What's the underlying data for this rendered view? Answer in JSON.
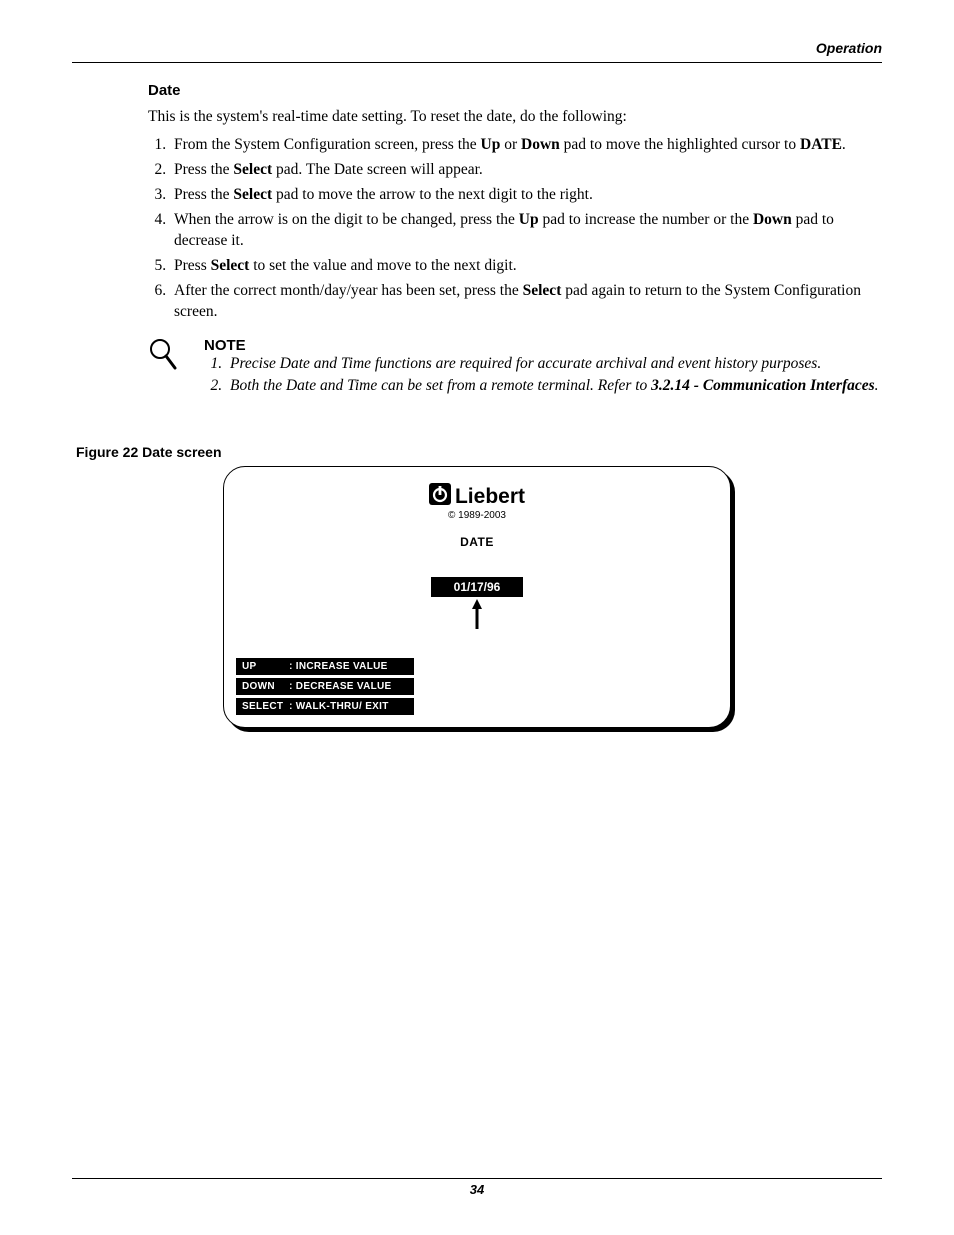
{
  "header": {
    "section": "Operation"
  },
  "section": {
    "heading": "Date",
    "intro": "This is the system's real-time date setting. To reset the date, do the following:",
    "steps": {
      "s1a": "From the System Configuration screen, press the ",
      "s1b": "Up",
      "s1c": " or ",
      "s1d": "Down",
      "s1e": " pad to move the highlighted cursor to ",
      "s1f": "DATE",
      "s1g": ".",
      "s2a": "Press the ",
      "s2b": "Select",
      "s2c": " pad. The Date screen will appear.",
      "s3a": "Press the ",
      "s3b": "Select",
      "s3c": " pad to move the arrow to the next digit to the right.",
      "s4a": "When the arrow is on the digit to be changed, press the ",
      "s4b": "Up",
      "s4c": " pad to increase the number or the ",
      "s4d": "Down",
      "s4e": " pad to decrease it.",
      "s5a": "Press ",
      "s5b": "Select",
      "s5c": " to set the value and move to the next digit.",
      "s6a": "After the correct month/day/year has been set, press the ",
      "s6b": "Select",
      "s6c": " pad again to return to the System Configuration screen."
    }
  },
  "note": {
    "title": "NOTE",
    "n1": "Precise Date and Time functions are required for accurate archival and event history purposes.",
    "n2a": "Both the Date and Time can be set from a remote terminal. Refer to ",
    "n2b": "3.2.14 - Communication Interfaces",
    "n2c": "."
  },
  "figure": {
    "caption": "Figure 22  Date screen"
  },
  "screen": {
    "brand": "Liebert",
    "copyright": "© 1989-2003",
    "title": "DATE",
    "value": "01/17/96",
    "legend": {
      "up_key": "UP",
      "up_val": "INCREASE VALUE",
      "down_key": "DOWN",
      "down_val": "DECREASE VALUE",
      "select_key": "SELECT",
      "select_val": "WALK-THRU/ EXIT"
    }
  },
  "footer": {
    "page": "34"
  }
}
